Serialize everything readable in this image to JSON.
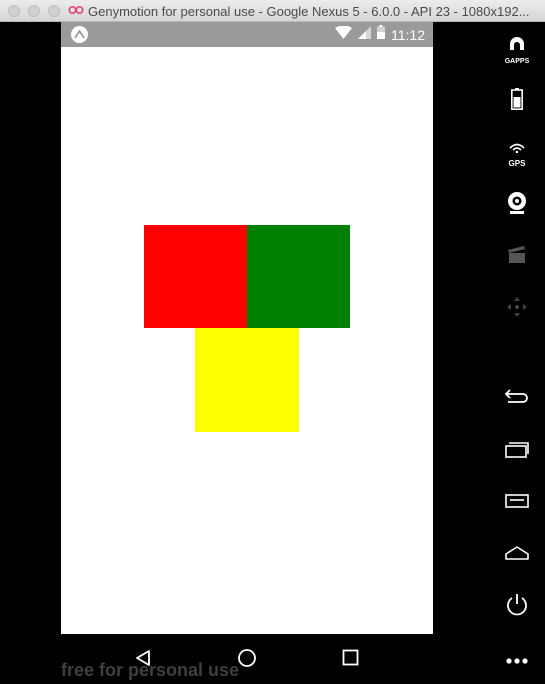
{
  "window": {
    "title": "Genymotion for personal use - Google Nexus 5 - 6.0.0 - API 23 - 1080x192..."
  },
  "statusbar": {
    "time": "11:12"
  },
  "content": {
    "boxes": [
      {
        "name": "red-box",
        "color": "#ff0000"
      },
      {
        "name": "green-box",
        "color": "#008000"
      },
      {
        "name": "yellow-box",
        "color": "#ffff00"
      }
    ]
  },
  "watermark": "free for personal use",
  "sidebar": {
    "tools": [
      {
        "icon": "gapps-icon",
        "label": "GAPPS"
      },
      {
        "icon": "battery-icon",
        "label": ""
      },
      {
        "icon": "gps-icon",
        "label": "GPS"
      },
      {
        "icon": "webcam-icon",
        "label": ""
      },
      {
        "icon": "clapper-icon",
        "label": ""
      },
      {
        "icon": "dpad-icon",
        "label": ""
      },
      {
        "icon": "back-icon",
        "label": ""
      },
      {
        "icon": "recent-apps-icon",
        "label": ""
      },
      {
        "icon": "menu-icon",
        "label": ""
      },
      {
        "icon": "home-icon",
        "label": ""
      },
      {
        "icon": "power-icon",
        "label": ""
      },
      {
        "icon": "more-icon",
        "label": ""
      }
    ]
  },
  "nav": {
    "buttons": [
      "back-icon",
      "home-icon",
      "recents-icon"
    ]
  }
}
